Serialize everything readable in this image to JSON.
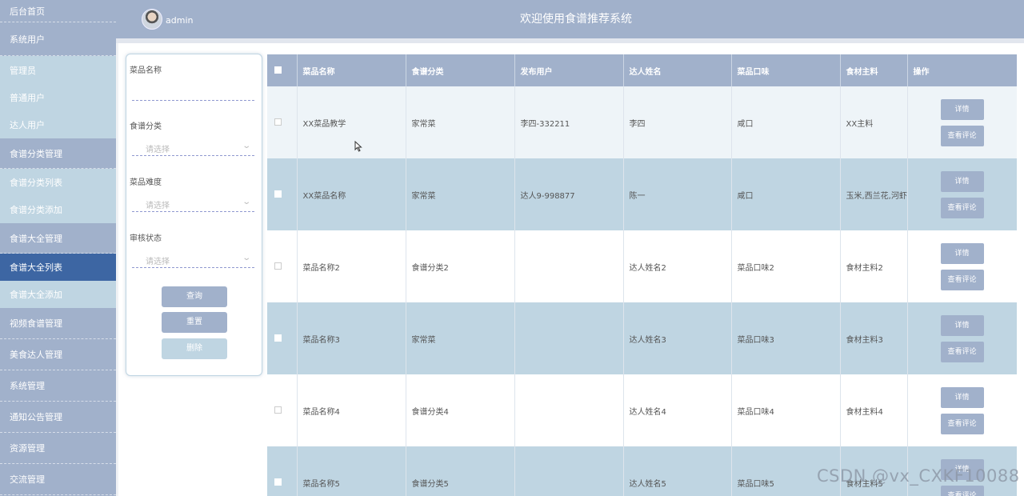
{
  "header": {
    "title": "欢迎使用食谱推荐系统",
    "username": "admin"
  },
  "sidebar": {
    "items": [
      {
        "label": "后台首页",
        "type": "top"
      },
      {
        "label": "系统用户",
        "type": "top"
      },
      {
        "label": "管理员",
        "type": "sub"
      },
      {
        "label": "普通用户",
        "type": "sub"
      },
      {
        "label": "达人用户",
        "type": "sub"
      },
      {
        "label": "食谱分类管理",
        "type": "top"
      },
      {
        "label": "食谱分类列表",
        "type": "sub"
      },
      {
        "label": "食谱分类添加",
        "type": "sub"
      },
      {
        "label": "食谱大全管理",
        "type": "top"
      },
      {
        "label": "食谱大全列表",
        "type": "active"
      },
      {
        "label": "食谱大全添加",
        "type": "sub"
      },
      {
        "label": "视频食谱管理",
        "type": "top"
      },
      {
        "label": "美食达人管理",
        "type": "top"
      },
      {
        "label": "系统管理",
        "type": "top"
      },
      {
        "label": "通知公告管理",
        "type": "top"
      },
      {
        "label": "资源管理",
        "type": "top"
      },
      {
        "label": "交流管理",
        "type": "top"
      }
    ]
  },
  "filter": {
    "dish_name_label": "菜品名称",
    "category_label": "食谱分类",
    "category_placeholder": "请选择",
    "difficulty_label": "菜品难度",
    "difficulty_placeholder": "请选择",
    "audit_label": "审核状态",
    "audit_placeholder": "请选择",
    "query_button": "查询",
    "reset_button": "重置",
    "delete_button": "删除"
  },
  "table": {
    "columns": [
      "菜品名称",
      "食谱分类",
      "发布用户",
      "达人姓名",
      "菜品口味",
      "食材主料",
      "操作"
    ],
    "detail_button": "详情",
    "comment_button": "查看评论",
    "rows": [
      [
        "XX菜品教学",
        "家常菜",
        "李四-332211",
        "李四",
        "咸口",
        "XX主料"
      ],
      [
        "XX菜品名称",
        "家常菜",
        "达人9-998877",
        "陈一",
        "咸口",
        "玉米,西兰花,河虾"
      ],
      [
        "菜品名称2",
        "食谱分类2",
        "",
        "达人姓名2",
        "菜品口味2",
        "食材主料2"
      ],
      [
        "菜品名称3",
        "家常菜",
        "",
        "达人姓名3",
        "菜品口味3",
        "食材主料3"
      ],
      [
        "菜品名称4",
        "食谱分类4",
        "",
        "达人姓名4",
        "菜品口味4",
        "食材主料4"
      ],
      [
        "菜品名称5",
        "食谱分类5",
        "",
        "达人姓名5",
        "菜品口味5",
        "食材主料5"
      ]
    ]
  },
  "watermark": "CSDN @vx_CXKF10088",
  "colors": {
    "sidebar": "#a1b1cb",
    "sidebar_sub": "#bfd5e2",
    "active": "#3d66a3"
  }
}
